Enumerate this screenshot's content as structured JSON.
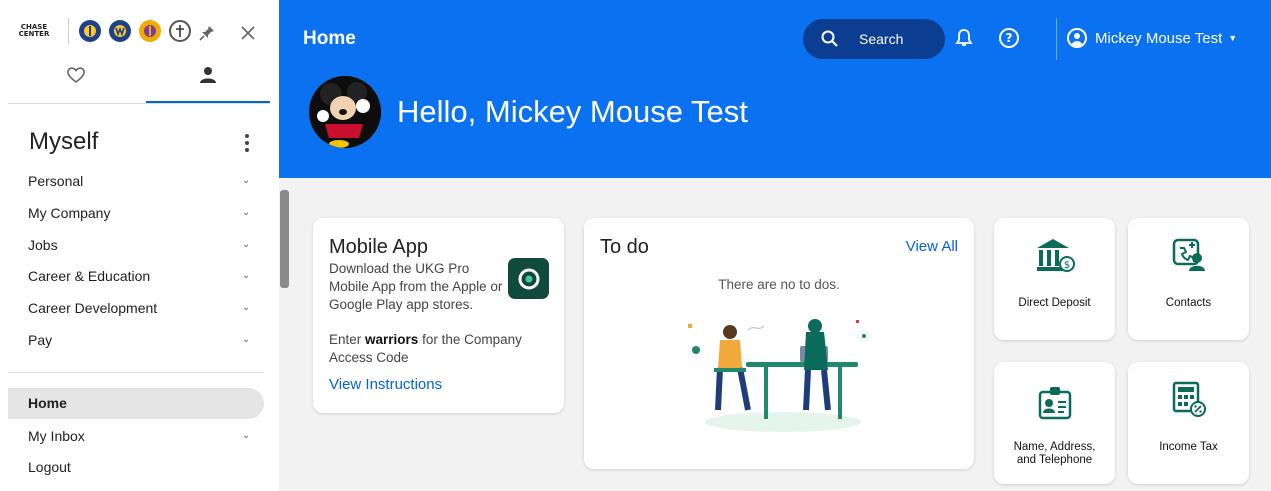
{
  "sidebar": {
    "logos": {
      "chase_line1": "CHASE",
      "chase_line2": "CENTER"
    },
    "section_title": "Myself",
    "menu": [
      {
        "label": "Personal"
      },
      {
        "label": "My Company"
      },
      {
        "label": "Jobs"
      },
      {
        "label": "Career & Education"
      },
      {
        "label": "Career Development"
      },
      {
        "label": "Pay"
      }
    ],
    "home_label": "Home",
    "inbox_label": "My Inbox",
    "logout_label": "Logout"
  },
  "header": {
    "title": "Home",
    "search_label": "Search",
    "user_name": "Mickey Mouse Test",
    "greeting": "Hello, Mickey Mouse Test"
  },
  "mobile_card": {
    "title": "Mobile App",
    "description": "Download the UKG Pro Mobile App from the Apple or Google Play app stores.",
    "code_prefix": "Enter ",
    "code_value": "warriors",
    "code_suffix": " for the Company Access Code",
    "link": "View Instructions"
  },
  "todo_card": {
    "title": "To do",
    "view_all": "View All",
    "empty": "There are no to dos."
  },
  "tiles": {
    "deposit": "Direct Deposit",
    "contacts": "Contacts",
    "name_line1": "Name, Address,",
    "name_line2": "and Telephone",
    "tax": "Income Tax"
  },
  "colors": {
    "header_bg": "#0a72f0",
    "search_bg": "#0b3d91",
    "link": "#0066cc",
    "tile_icon": "#0b6b5a"
  },
  "icons": [
    "heart-icon",
    "person-icon",
    "pin-icon",
    "close-icon",
    "search-icon",
    "bell-icon",
    "help-icon",
    "user-circle-icon",
    "bank-icon",
    "contacts-icon",
    "id-badge-icon",
    "calculator-icon"
  ]
}
